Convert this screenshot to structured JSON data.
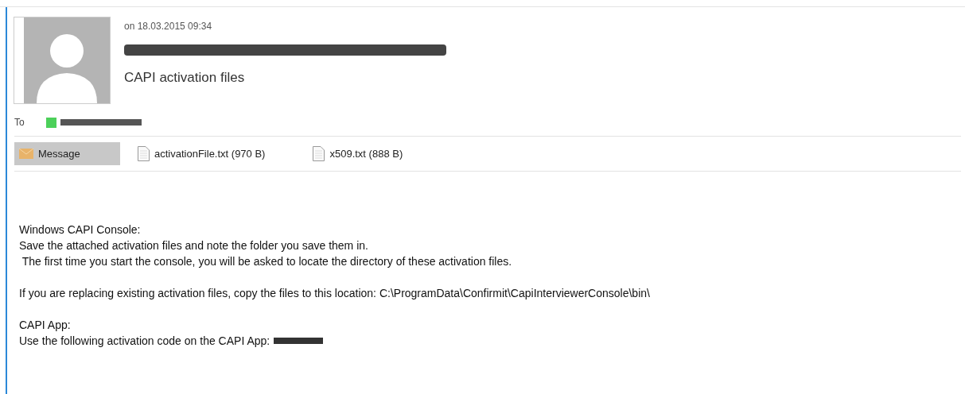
{
  "header": {
    "date": "on 18.03.2015 09:34",
    "subject": "CAPI activation files",
    "to_label": "To",
    "recipient": {
      "color": "#4cd05a"
    }
  },
  "tabs": [
    {
      "label": "Message",
      "kind": "message",
      "selected": true
    },
    {
      "label": "activationFile.txt (970 B)",
      "kind": "file",
      "selected": false
    },
    {
      "label": "x509.txt (888 B)",
      "kind": "file",
      "selected": false
    }
  ],
  "body": [
    {
      "lines": [
        {
          "text": "Windows CAPI Console:",
          "redacted_tail": false
        },
        {
          "text": "Save the attached activation files and note the folder you save them in.",
          "redacted_tail": false
        },
        {
          "text": " The first time you start the console, you will be asked to locate the directory of these activation files.",
          "redacted_tail": false
        }
      ]
    },
    {
      "lines": [
        {
          "text": "If you are replacing existing activation files, copy the files to this location: C:\\ProgramData\\Confirmit\\CapiInterviewerConsole\\bin\\",
          "redacted_tail": false
        }
      ]
    },
    {
      "lines": [
        {
          "text": "CAPI App:",
          "redacted_tail": false
        },
        {
          "text": "Use the following activation code on the CAPI App:",
          "redacted_tail": true
        }
      ]
    }
  ]
}
